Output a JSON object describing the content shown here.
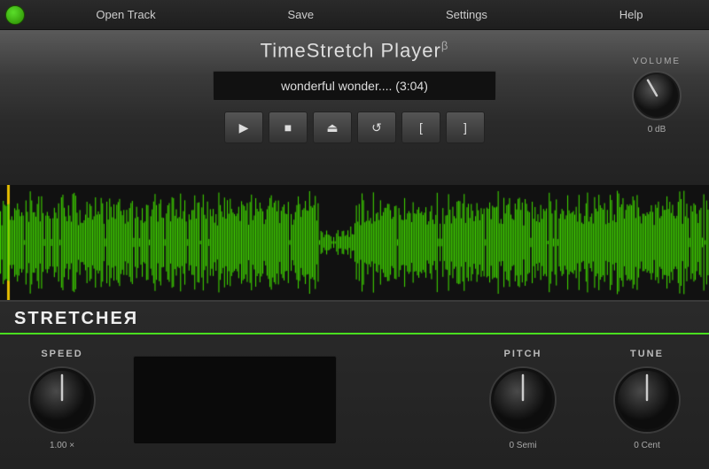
{
  "menu": {
    "logo_alt": "TimeStretch Logo",
    "items": [
      {
        "label": "Open Track",
        "id": "open-track"
      },
      {
        "label": "Save",
        "id": "save"
      },
      {
        "label": "Settings",
        "id": "settings"
      },
      {
        "label": "Help",
        "id": "help"
      }
    ]
  },
  "header": {
    "title": "TimeStretch Player",
    "title_superscript": "β",
    "track_name": "wonderful wonder....  (3:04)"
  },
  "transport": {
    "play_symbol": "▶",
    "stop_symbol": "■",
    "eject_symbol": "⏏",
    "loop_symbol": "↺",
    "mark_in_symbol": "[",
    "mark_out_symbol": "]"
  },
  "volume": {
    "label": "VOLUME",
    "value": "0  dB",
    "rotation": -30
  },
  "stretcher": {
    "title": "STRETCHEЯ",
    "speed": {
      "label": "SPEED",
      "value": "1.00 ×",
      "rotation": 0
    },
    "pitch": {
      "label": "PITCH",
      "value": "0  Semi",
      "rotation": 0
    },
    "tune": {
      "label": "TUNE",
      "value": "0  Cent",
      "rotation": 0
    }
  },
  "colors": {
    "accent_green": "#4ade20",
    "waveform_green": "#3ecf00",
    "bg_dark": "#1a1a1a",
    "bg_medium": "#2a2a2a",
    "knob_body": "#222",
    "knob_ring": "#555"
  }
}
